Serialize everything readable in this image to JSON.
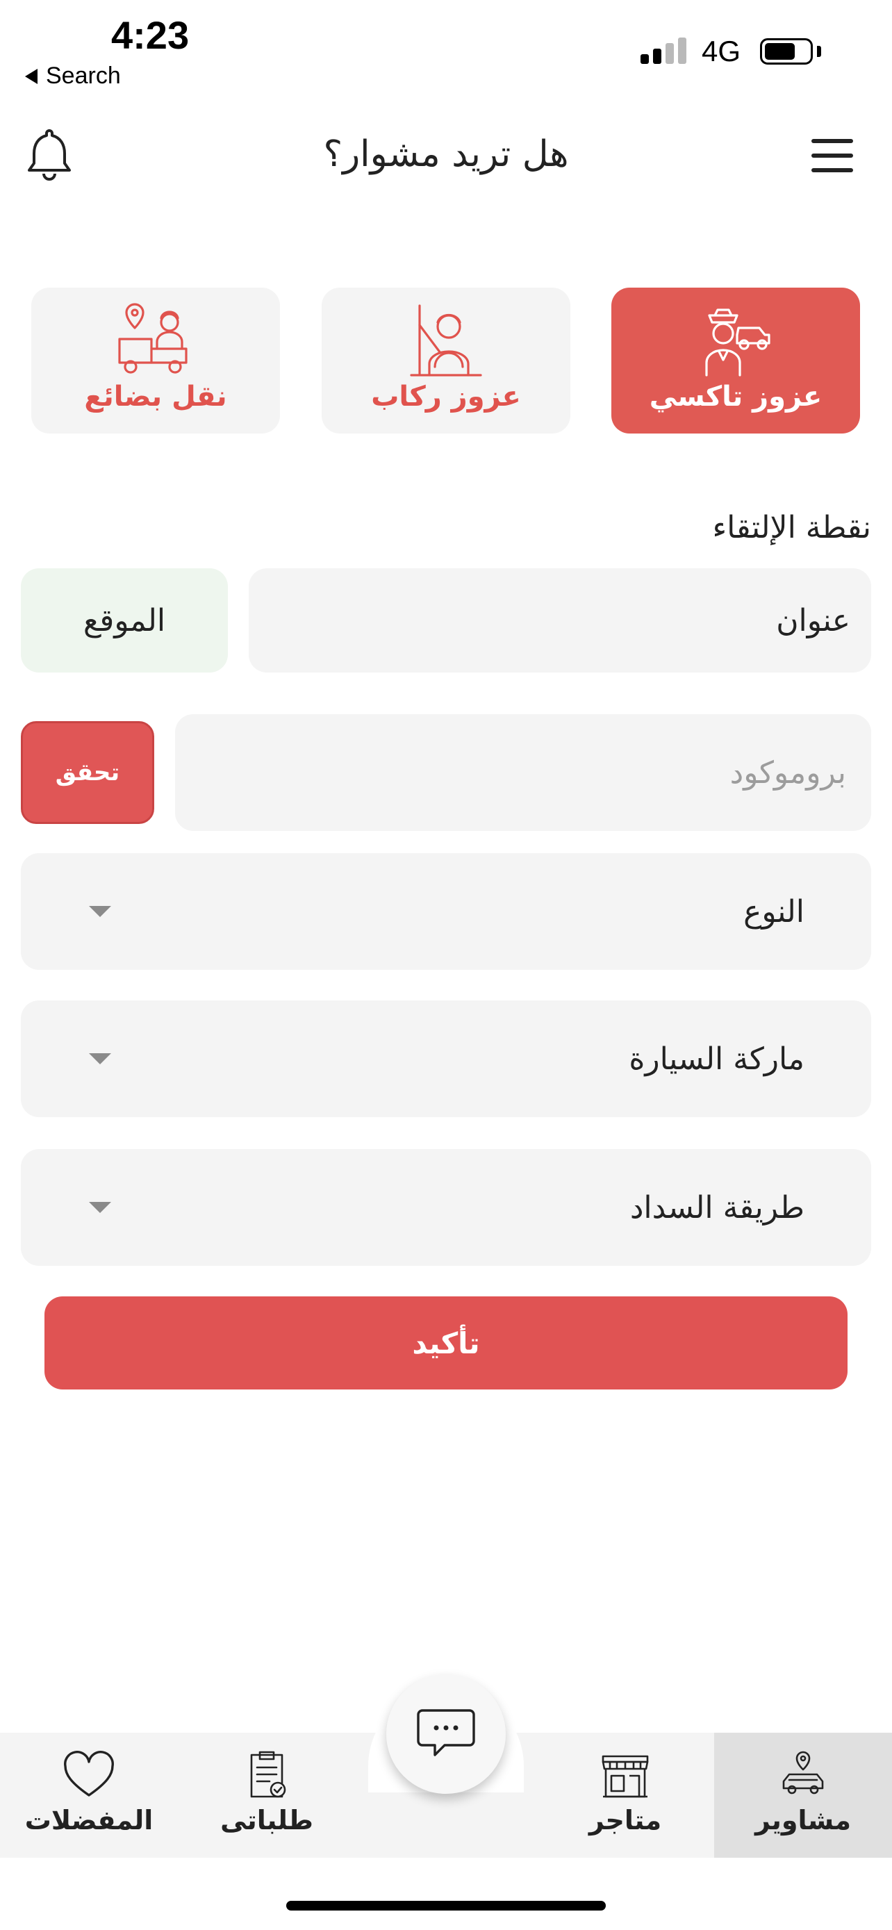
{
  "status_bar": {
    "time": "4:23",
    "back_label": "Search",
    "network": "4G",
    "signal_bars_on": 2,
    "signal_bars_total": 4,
    "battery_level": 0.7
  },
  "header": {
    "title": "هل تريد مشوار؟",
    "menu_icon": "hamburger-menu-icon",
    "notification_icon": "bell-icon"
  },
  "services": [
    {
      "label": "عزوز تاكسي",
      "icon": "taxi-driver-icon",
      "active": true
    },
    {
      "label": "عزوز ركاب",
      "icon": "passenger-driver-icon",
      "active": false
    },
    {
      "label": "نقل بضائع",
      "icon": "cargo-truck-icon",
      "active": false
    }
  ],
  "pickup": {
    "section_label": "نقطة الإلتقاء",
    "address_value": "عنوان",
    "location_button": "الموقع"
  },
  "promo": {
    "placeholder": "بروموكود",
    "verify_button": "تحقق"
  },
  "dropdowns": {
    "type": "النوع",
    "car_brand": "ماركة السيارة",
    "payment_method": "طريقة السداد"
  },
  "confirm_button": "تأكيد",
  "bottom_nav": {
    "trips": "مشاوير",
    "stores": "متاجر",
    "orders": "طلباتى",
    "favorites": "المفضلات",
    "chat_icon": "chat-bubble-icon"
  },
  "colors": {
    "accent": "#e05a54",
    "button_red": "#e05353",
    "field_bg": "#f4f4f4",
    "location_bg": "#eef6ee"
  }
}
